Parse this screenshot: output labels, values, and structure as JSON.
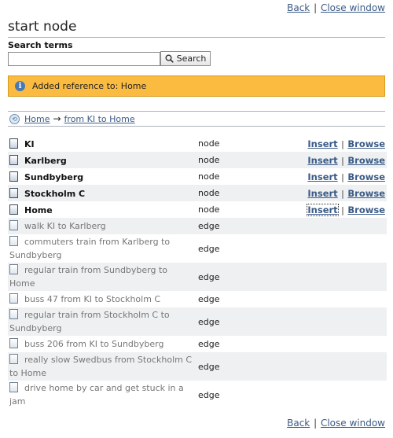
{
  "nav": {
    "back_label": "Back",
    "separator": "|",
    "close_label": "Close window"
  },
  "title": "start node",
  "search": {
    "label": "Search terms",
    "value": "",
    "placeholder": "",
    "button_label": "Search"
  },
  "notice": {
    "text": "Added reference to: Home"
  },
  "breadcrumb": {
    "home": "Home",
    "arrow": "→",
    "current": "from KI to Home"
  },
  "actions": {
    "insert": "Insert",
    "browse": "Browse"
  },
  "rows": [
    {
      "name": "KI",
      "type": "node"
    },
    {
      "name": "Karlberg",
      "type": "node"
    },
    {
      "name": "Sundbyberg",
      "type": "node"
    },
    {
      "name": "Stockholm C",
      "type": "node"
    },
    {
      "name": "Home",
      "type": "node"
    },
    {
      "name": "walk KI to Karlberg",
      "type": "edge"
    },
    {
      "name": "commuters train from Karlberg to Sundbyberg",
      "type": "edge"
    },
    {
      "name": "regular train from Sundbyberg to Home",
      "type": "edge"
    },
    {
      "name": "buss 47 from KI to Stockholm C",
      "type": "edge"
    },
    {
      "name": "regular train from Stockholm C to Sundbyberg",
      "type": "edge"
    },
    {
      "name": "buss 206 from KI to Sundbyberg",
      "type": "edge"
    },
    {
      "name": "really slow Swedbus from Stockholm C to Home",
      "type": "edge"
    },
    {
      "name": "drive home by car and get stuck in a jam",
      "type": "edge"
    }
  ]
}
